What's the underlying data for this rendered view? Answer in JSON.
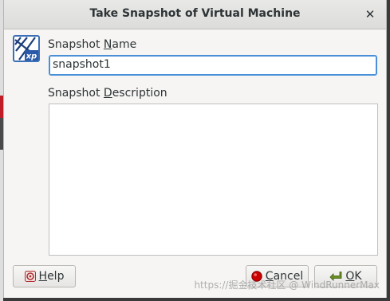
{
  "dialog": {
    "title": "Take Snapshot of Virtual Machine",
    "close_icon": "✕"
  },
  "vm_icon": {
    "name": "windows-xp-icon",
    "badge_text": "xp",
    "colors": {
      "frame": "#3b6fb6",
      "badge": "#2a5aa8"
    }
  },
  "snapshot_name": {
    "label_pre": "Snapshot ",
    "label_mnemonic": "N",
    "label_post": "ame",
    "value": "snapshot1"
  },
  "snapshot_description": {
    "label_pre": "Snapshot ",
    "label_mnemonic": "D",
    "label_post": "escription",
    "value": ""
  },
  "buttons": {
    "help_mnemonic": "H",
    "help_rest": "elp",
    "cancel_mnemonic": "C",
    "cancel_rest": "ancel",
    "ok_mnemonic": "O",
    "ok_rest": "K"
  },
  "watermark": "https://掘金技术社区 @ WindRunnerMax",
  "colors": {
    "focus_border": "#4a90d9",
    "cancel_red": "#cc0000"
  }
}
